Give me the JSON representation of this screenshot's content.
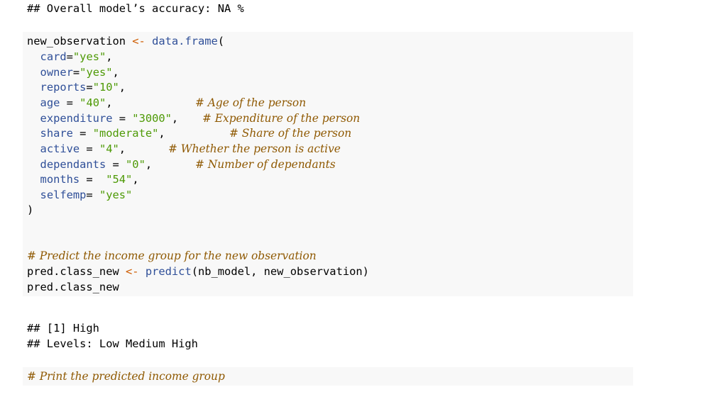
{
  "output_top": {
    "line1": "## Overall model’s accuracy: NA %"
  },
  "block1": {
    "line_assign": {
      "var": "new_observation",
      "op": "<-",
      "fn": "data.frame",
      "open": "("
    },
    "args": [
      {
        "name": "card",
        "eq": "=",
        "val": "\"yes\"",
        "tail": ",",
        "comment": ""
      },
      {
        "name": "owner",
        "eq": "=",
        "val": "\"yes\"",
        "tail": ",",
        "comment": ""
      },
      {
        "name": "reports",
        "eq": "=",
        "val": "\"10\"",
        "tail": ",",
        "comment": ""
      },
      {
        "name": "age",
        "eq": " = ",
        "val": "\"40\"",
        "tail": ",",
        "comment": "# Age of the person"
      },
      {
        "name": "expenditure",
        "eq": " = ",
        "val": "\"3000\"",
        "tail": ",",
        "comment": "# Expenditure of the person"
      },
      {
        "name": "share",
        "eq": " = ",
        "val": "\"moderate\"",
        "tail": ",",
        "comment": "# Share of the person"
      },
      {
        "name": "active",
        "eq": " = ",
        "val": "\"4\"",
        "tail": ",",
        "comment": "# Whether the person is active"
      },
      {
        "name": "dependants",
        "eq": " = ",
        "val": "\"0\"",
        "tail": ",",
        "comment": "# Number of dependants"
      },
      {
        "name": "months",
        "eq": " =  ",
        "val": "\"54\"",
        "tail": ",",
        "comment": ""
      },
      {
        "name": "selfemp",
        "eq": "= ",
        "val": "\"yes\"",
        "tail": "",
        "comment": ""
      }
    ],
    "close": ")",
    "comment_predict": "# Predict the income group for the new observation",
    "pred_line": {
      "var": "pred.class_new",
      "op": "<-",
      "fn": "predict",
      "args": "(nb_model, new_observation)"
    },
    "print_line": "pred.class_new"
  },
  "output_mid": {
    "line1": "## [1] High",
    "line2": "## Levels: Low Medium High"
  },
  "block2": {
    "comment": "# Print the predicted income group"
  }
}
